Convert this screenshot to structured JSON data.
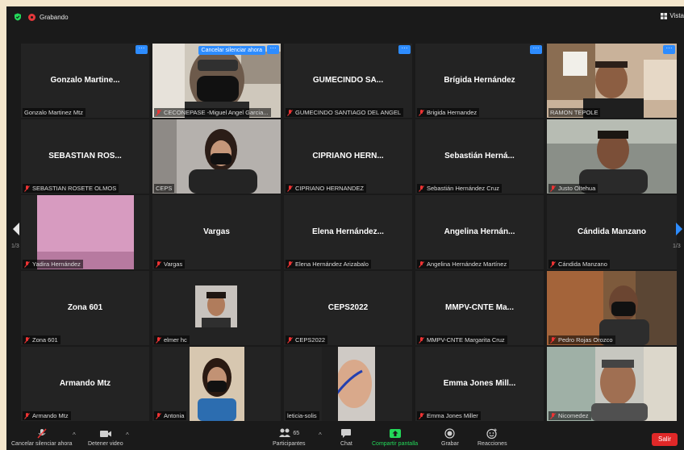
{
  "topbar": {
    "recording_label": "Grabando",
    "view_label": "Vista"
  },
  "pagination": {
    "left": "1/3",
    "right": "1/3"
  },
  "unmute_request": "Cancelar silenciar ahora",
  "tiles": [
    {
      "name": "Gonzalo Martine...",
      "label": "Gonzalo Martinez Mtz",
      "muted": false
    },
    {
      "name": "",
      "label": "CECONEPASE -Miguel Angel Garcia...",
      "muted": true
    },
    {
      "name": "GUMECINDO SA...",
      "label": "GUMECINDO SANTIAGO DEL ANGEL",
      "muted": true
    },
    {
      "name": "Brígida Hernández",
      "label": "Brigida Hernandez",
      "muted": true
    },
    {
      "name": "",
      "label": "RAMON TEPOLE",
      "muted": false
    },
    {
      "name": "SEBASTIAN ROS...",
      "label": "SEBASTIAN ROSETE OLMOS",
      "muted": true
    },
    {
      "name": "",
      "label": "CEPS",
      "muted": false
    },
    {
      "name": "CIPRIANO HERN...",
      "label": "CIPRIANO HERNANDEZ",
      "muted": true
    },
    {
      "name": "Sebastián Herná...",
      "label": "Sebastián Hernández Cruz",
      "muted": true
    },
    {
      "name": "",
      "label": "Justo Oltehua",
      "muted": true
    },
    {
      "name": "",
      "label": "Yadira Hernández",
      "muted": true
    },
    {
      "name": "Vargas",
      "label": "Vargas",
      "muted": true
    },
    {
      "name": "Elena Hernández...",
      "label": "Elena Hernández Arizabalo",
      "muted": true
    },
    {
      "name": "Angelina Hernán...",
      "label": "Angelina Hernández Martínez",
      "muted": true
    },
    {
      "name": "Cándida Manzano",
      "label": "Cándida Manzano",
      "muted": true
    },
    {
      "name": "Zona 601",
      "label": "Zona 601",
      "muted": true
    },
    {
      "name": "",
      "label": "elmer hc",
      "muted": true
    },
    {
      "name": "CEPS2022",
      "label": "CEPS2022",
      "muted": true
    },
    {
      "name": "MMPV-CNTE Ma...",
      "label": "MMPV-CNTE Margarita Cruz",
      "muted": true
    },
    {
      "name": "",
      "label": "Pedro Rojas Orozco",
      "muted": true
    },
    {
      "name": "Armando Mtz",
      "label": "Armando Mtz",
      "muted": true
    },
    {
      "name": "",
      "label": "Antonia",
      "muted": true
    },
    {
      "name": "",
      "label": "leticia-solis",
      "muted": false
    },
    {
      "name": "Emma Jones Mill...",
      "label": "Emma Jones Miller",
      "muted": true
    },
    {
      "name": "",
      "label": "Nicomedez",
      "muted": true
    }
  ],
  "toolbar": {
    "unmute": "Cancelar silenciar ahora",
    "video": "Detener video",
    "participants": "Participantes",
    "participants_count": "65",
    "chat": "Chat",
    "share": "Compartir pantalla",
    "record": "Grabar",
    "reactions": "Reacciones",
    "leave": "Salir"
  },
  "colors": {
    "share": "#23d959",
    "leave": "#e02828",
    "accent": "#2d8cff",
    "active_speaker": "#c8df5a"
  }
}
